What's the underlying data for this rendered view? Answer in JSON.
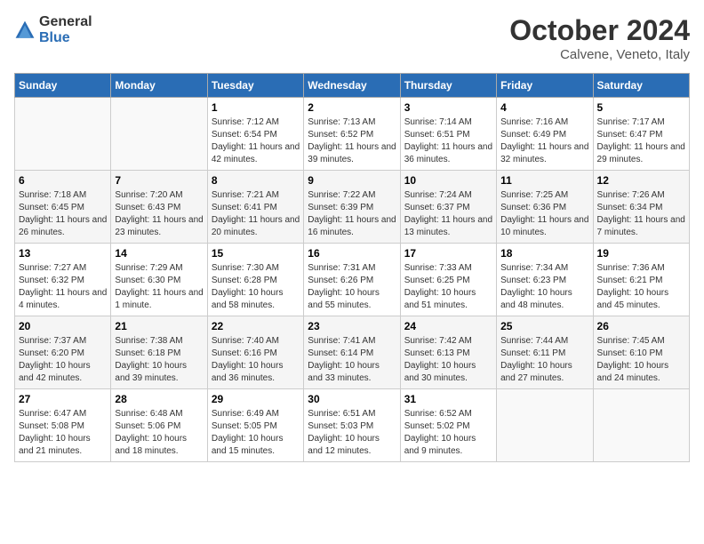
{
  "header": {
    "logo_line1": "General",
    "logo_line2": "Blue",
    "month": "October 2024",
    "location": "Calvene, Veneto, Italy"
  },
  "days_of_week": [
    "Sunday",
    "Monday",
    "Tuesday",
    "Wednesday",
    "Thursday",
    "Friday",
    "Saturday"
  ],
  "weeks": [
    [
      {
        "day": "",
        "sunrise": "",
        "sunset": "",
        "daylight": ""
      },
      {
        "day": "",
        "sunrise": "",
        "sunset": "",
        "daylight": ""
      },
      {
        "day": "1",
        "sunrise": "Sunrise: 7:12 AM",
        "sunset": "Sunset: 6:54 PM",
        "daylight": "Daylight: 11 hours and 42 minutes."
      },
      {
        "day": "2",
        "sunrise": "Sunrise: 7:13 AM",
        "sunset": "Sunset: 6:52 PM",
        "daylight": "Daylight: 11 hours and 39 minutes."
      },
      {
        "day": "3",
        "sunrise": "Sunrise: 7:14 AM",
        "sunset": "Sunset: 6:51 PM",
        "daylight": "Daylight: 11 hours and 36 minutes."
      },
      {
        "day": "4",
        "sunrise": "Sunrise: 7:16 AM",
        "sunset": "Sunset: 6:49 PM",
        "daylight": "Daylight: 11 hours and 32 minutes."
      },
      {
        "day": "5",
        "sunrise": "Sunrise: 7:17 AM",
        "sunset": "Sunset: 6:47 PM",
        "daylight": "Daylight: 11 hours and 29 minutes."
      }
    ],
    [
      {
        "day": "6",
        "sunrise": "Sunrise: 7:18 AM",
        "sunset": "Sunset: 6:45 PM",
        "daylight": "Daylight: 11 hours and 26 minutes."
      },
      {
        "day": "7",
        "sunrise": "Sunrise: 7:20 AM",
        "sunset": "Sunset: 6:43 PM",
        "daylight": "Daylight: 11 hours and 23 minutes."
      },
      {
        "day": "8",
        "sunrise": "Sunrise: 7:21 AM",
        "sunset": "Sunset: 6:41 PM",
        "daylight": "Daylight: 11 hours and 20 minutes."
      },
      {
        "day": "9",
        "sunrise": "Sunrise: 7:22 AM",
        "sunset": "Sunset: 6:39 PM",
        "daylight": "Daylight: 11 hours and 16 minutes."
      },
      {
        "day": "10",
        "sunrise": "Sunrise: 7:24 AM",
        "sunset": "Sunset: 6:37 PM",
        "daylight": "Daylight: 11 hours and 13 minutes."
      },
      {
        "day": "11",
        "sunrise": "Sunrise: 7:25 AM",
        "sunset": "Sunset: 6:36 PM",
        "daylight": "Daylight: 11 hours and 10 minutes."
      },
      {
        "day": "12",
        "sunrise": "Sunrise: 7:26 AM",
        "sunset": "Sunset: 6:34 PM",
        "daylight": "Daylight: 11 hours and 7 minutes."
      }
    ],
    [
      {
        "day": "13",
        "sunrise": "Sunrise: 7:27 AM",
        "sunset": "Sunset: 6:32 PM",
        "daylight": "Daylight: 11 hours and 4 minutes."
      },
      {
        "day": "14",
        "sunrise": "Sunrise: 7:29 AM",
        "sunset": "Sunset: 6:30 PM",
        "daylight": "Daylight: 11 hours and 1 minute."
      },
      {
        "day": "15",
        "sunrise": "Sunrise: 7:30 AM",
        "sunset": "Sunset: 6:28 PM",
        "daylight": "Daylight: 10 hours and 58 minutes."
      },
      {
        "day": "16",
        "sunrise": "Sunrise: 7:31 AM",
        "sunset": "Sunset: 6:26 PM",
        "daylight": "Daylight: 10 hours and 55 minutes."
      },
      {
        "day": "17",
        "sunrise": "Sunrise: 7:33 AM",
        "sunset": "Sunset: 6:25 PM",
        "daylight": "Daylight: 10 hours and 51 minutes."
      },
      {
        "day": "18",
        "sunrise": "Sunrise: 7:34 AM",
        "sunset": "Sunset: 6:23 PM",
        "daylight": "Daylight: 10 hours and 48 minutes."
      },
      {
        "day": "19",
        "sunrise": "Sunrise: 7:36 AM",
        "sunset": "Sunset: 6:21 PM",
        "daylight": "Daylight: 10 hours and 45 minutes."
      }
    ],
    [
      {
        "day": "20",
        "sunrise": "Sunrise: 7:37 AM",
        "sunset": "Sunset: 6:20 PM",
        "daylight": "Daylight: 10 hours and 42 minutes."
      },
      {
        "day": "21",
        "sunrise": "Sunrise: 7:38 AM",
        "sunset": "Sunset: 6:18 PM",
        "daylight": "Daylight: 10 hours and 39 minutes."
      },
      {
        "day": "22",
        "sunrise": "Sunrise: 7:40 AM",
        "sunset": "Sunset: 6:16 PM",
        "daylight": "Daylight: 10 hours and 36 minutes."
      },
      {
        "day": "23",
        "sunrise": "Sunrise: 7:41 AM",
        "sunset": "Sunset: 6:14 PM",
        "daylight": "Daylight: 10 hours and 33 minutes."
      },
      {
        "day": "24",
        "sunrise": "Sunrise: 7:42 AM",
        "sunset": "Sunset: 6:13 PM",
        "daylight": "Daylight: 10 hours and 30 minutes."
      },
      {
        "day": "25",
        "sunrise": "Sunrise: 7:44 AM",
        "sunset": "Sunset: 6:11 PM",
        "daylight": "Daylight: 10 hours and 27 minutes."
      },
      {
        "day": "26",
        "sunrise": "Sunrise: 7:45 AM",
        "sunset": "Sunset: 6:10 PM",
        "daylight": "Daylight: 10 hours and 24 minutes."
      }
    ],
    [
      {
        "day": "27",
        "sunrise": "Sunrise: 6:47 AM",
        "sunset": "Sunset: 5:08 PM",
        "daylight": "Daylight: 10 hours and 21 minutes."
      },
      {
        "day": "28",
        "sunrise": "Sunrise: 6:48 AM",
        "sunset": "Sunset: 5:06 PM",
        "daylight": "Daylight: 10 hours and 18 minutes."
      },
      {
        "day": "29",
        "sunrise": "Sunrise: 6:49 AM",
        "sunset": "Sunset: 5:05 PM",
        "daylight": "Daylight: 10 hours and 15 minutes."
      },
      {
        "day": "30",
        "sunrise": "Sunrise: 6:51 AM",
        "sunset": "Sunset: 5:03 PM",
        "daylight": "Daylight: 10 hours and 12 minutes."
      },
      {
        "day": "31",
        "sunrise": "Sunrise: 6:52 AM",
        "sunset": "Sunset: 5:02 PM",
        "daylight": "Daylight: 10 hours and 9 minutes."
      },
      {
        "day": "",
        "sunrise": "",
        "sunset": "",
        "daylight": ""
      },
      {
        "day": "",
        "sunrise": "",
        "sunset": "",
        "daylight": ""
      }
    ]
  ]
}
